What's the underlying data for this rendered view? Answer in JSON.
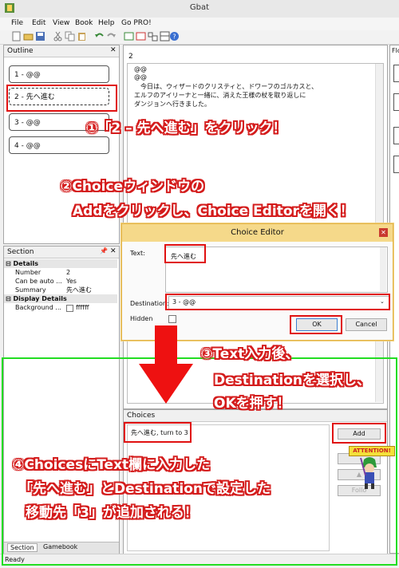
{
  "window": {
    "title": "Gbat"
  },
  "menu": [
    "File",
    "Edit",
    "View",
    "Book",
    "Help",
    "Go PRO!"
  ],
  "outline": {
    "header": "Outline",
    "nodes": [
      "1 - @@",
      "2 - 先へ進む",
      "3 - @@",
      "4 - @@"
    ]
  },
  "editor": {
    "page_number": "2",
    "lines": [
      "@@",
      "@@",
      "　今日は、ウィザードのクリスティと、ドワーフのゴルカスと、",
      "エルフのアイリーナと一緒に、消えた王様の杖を取り返しに",
      "ダンジョンへ行きました。"
    ]
  },
  "right_panel": {
    "header": "Flo"
  },
  "section": {
    "header": "Section",
    "categories": [
      {
        "name": "Details",
        "rows": [
          {
            "key": "Number",
            "value": "2"
          },
          {
            "key": "Can be auto ...",
            "value": "Yes"
          },
          {
            "key": "Summary",
            "value": "先へ進む"
          }
        ]
      },
      {
        "name": "Display Details",
        "rows": [
          {
            "key": "Background ...",
            "value": "ffffff"
          }
        ]
      }
    ],
    "tabs": [
      "Section",
      "Gamebook"
    ]
  },
  "choice_editor": {
    "title": "Choice Editor",
    "text_label": "Text:",
    "text_value": "先へ進む",
    "destination_label": "Destination:",
    "destination_value": "3 - @@",
    "hidden_label": "Hidden",
    "ok": "OK",
    "cancel": "Cancel"
  },
  "choices": {
    "header": "Choices",
    "items": [
      "先へ進む, turn to 3"
    ],
    "add": "Add",
    "follow": "Follo"
  },
  "status": {
    "text": "Ready"
  },
  "badge": {
    "text": "ATTENTION!"
  },
  "annotations": {
    "step1": "①「2 – 先へ進む」をクリック！",
    "step2_line1": "②Choiceウィンドウの",
    "step2_line2": "Addをクリックし、Choice Editorを開く！",
    "step3_line1": "③Text入力後、",
    "step3_line2": "Destinationを選択し、",
    "step3_line3": "OKを押す！",
    "step4_line1": "④ChoicesにText欄に入力した",
    "step4_line2": "「先へ進む」とDestinationで設定した",
    "step4_line3": "移動先「3」が追加される！"
  },
  "colors": {
    "annotation_red": "#d41c1c",
    "highlight_green": "#22dd22",
    "dialog_border": "#e3b44a"
  }
}
